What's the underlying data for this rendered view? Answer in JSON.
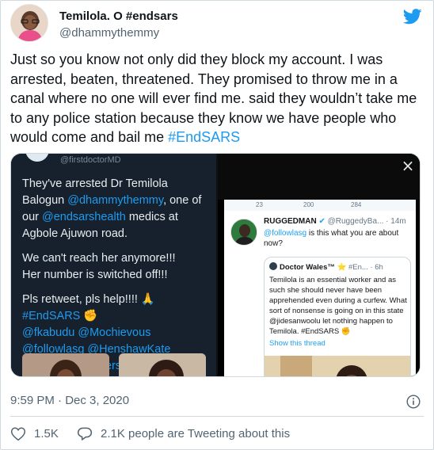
{
  "author": {
    "display_name": "Temilola. O #endsars",
    "handle": "@dhammythemmy"
  },
  "tweet": {
    "text_before": "Just so you know not only did they block my account. I was arrested, beaten, threatened. They promised to throw me in a canal where no one will ever find me. said they wouldn’t take me to any police station because they know we have people who would come and bail me ",
    "hashtag": "#EndSARS"
  },
  "media_left": {
    "header_handle": "@firstdoctorMD",
    "p1_a": "They've arrested Dr Temilola Balogun ",
    "p1_link1": "@dhammythemmy",
    "p1_b": ", one of our ",
    "p1_link2": "@endsarshealth",
    "p1_c": " medics at Agbole Ajuwon road.",
    "p2_line1": "We can't reach her anymore!!!",
    "p2_line2": "Her number is switched off!!!",
    "p3": "Pls retweet, pls help!!!! 🙏",
    "p3_hashtag": "#EndSARS ✊",
    "p3_mentions": "@fkabudu @Mochievous @followlasg @HenshawKate @SaharaReporters"
  },
  "media_right": {
    "close_symbol": "×",
    "actions": {
      "replies": "23",
      "retweets": "200",
      "likes": "284"
    },
    "name": "RUGGEDMAN",
    "sub": "@RuggedyBa... · 14m",
    "body_link": "@followlasg",
    "body_text": " is this what you are about now?",
    "quote": {
      "name": "Doctor Wales™",
      "sub": "#En... · 6h",
      "body": "Temilola is an essential worker and as such she should never have been apprehended even during a curfew. What sort of nonsense is going on in this state @jidesanwoolu let nothing happen to Temilola. #EndSARS ✊",
      "show_thread": "Show this thread"
    }
  },
  "meta": {
    "timestamp": "9:59 PM · Dec 3, 2020"
  },
  "footer": {
    "like_count": "1.5K",
    "reply_text": "2.1K people are Tweeting about this"
  },
  "colors": {
    "twitter_blue": "#1d9bf0",
    "text_primary": "#0f1419",
    "text_secondary": "#536471",
    "border": "#cfd9de"
  }
}
